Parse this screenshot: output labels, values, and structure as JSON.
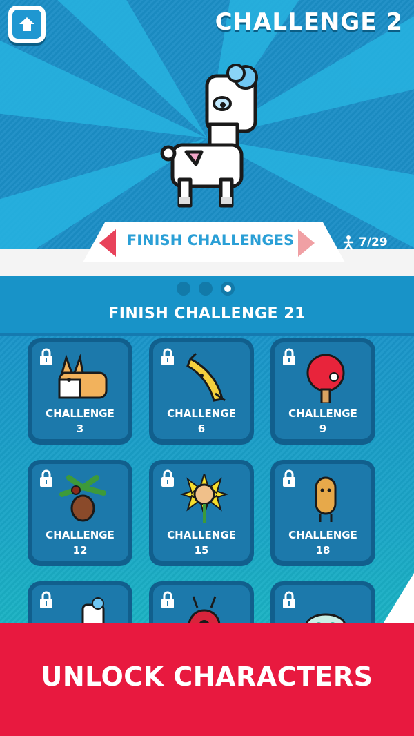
{
  "header": {
    "title": "CHALLENGE 2",
    "home_icon": "home-icon"
  },
  "selector": {
    "label": "FINISH CHALLENGES",
    "progress": "7/29",
    "progress_icon": "runner-icon"
  },
  "pager": {
    "count": 3,
    "active_index": 2
  },
  "section": {
    "title": "FINISH CHALLENGE 21"
  },
  "cards": [
    {
      "title": "CHALLENGE",
      "number": "3",
      "character": "corgi",
      "locked": true
    },
    {
      "title": "CHALLENGE",
      "number": "6",
      "character": "banana",
      "locked": true
    },
    {
      "title": "CHALLENGE",
      "number": "9",
      "character": "ping-pong-paddle",
      "locked": true
    },
    {
      "title": "CHALLENGE",
      "number": "12",
      "character": "coconut-tree",
      "locked": true
    },
    {
      "title": "CHALLENGE",
      "number": "15",
      "character": "sunflower",
      "locked": true
    },
    {
      "title": "CHALLENGE",
      "number": "18",
      "character": "potato",
      "locked": true
    },
    {
      "title": "",
      "number": "",
      "character": "llama",
      "locked": true
    },
    {
      "title": "",
      "number": "",
      "character": "ladybug",
      "locked": true
    },
    {
      "title": "",
      "number": "",
      "character": "mask",
      "locked": true
    }
  ],
  "banner": {
    "text": "UNLOCK CHARACTERS"
  },
  "colors": {
    "sky": "#1b8ec6",
    "ray": "#27b3e0",
    "accent_red": "#e8193f",
    "text_blue": "#2a9fd6",
    "card_dark": "#115f8d"
  }
}
